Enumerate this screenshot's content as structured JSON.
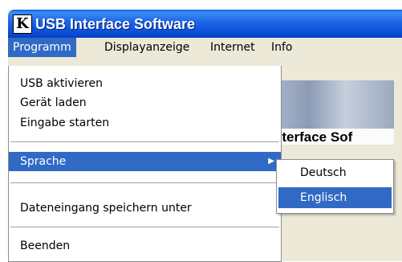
{
  "window": {
    "title": "USB Interface Software",
    "app_icon_letter": "K"
  },
  "menubar": {
    "items": [
      "Programm",
      "Displayanzeige",
      "Internet",
      "Info"
    ],
    "active": "Programm"
  },
  "background": {
    "heading_fragment": "nterface Sof"
  },
  "programm_menu": {
    "items": [
      "USB aktivieren",
      "Gerät laden",
      "Eingabe starten",
      "Sprache",
      "Dateneingang speichern unter",
      "Beenden"
    ],
    "highlighted": "Sprache"
  },
  "sprache_submenu": {
    "items": [
      "Deutsch",
      "Englisch"
    ],
    "highlighted": "Englisch"
  },
  "colors": {
    "highlight": "#316ac5",
    "titlebar": "#0a4fd8",
    "menu_bg": "#ece9d8"
  }
}
